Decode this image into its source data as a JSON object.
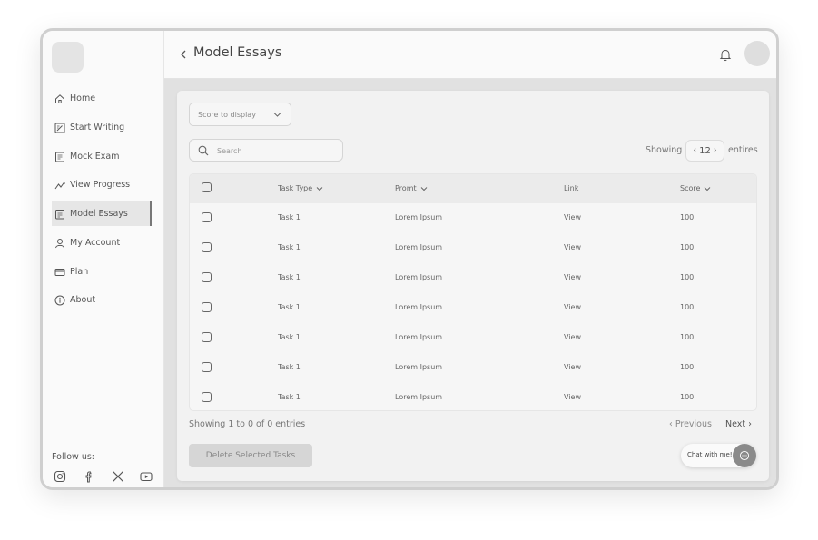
{
  "sidebar": {
    "items": [
      {
        "label": "Home",
        "icon": "home-icon"
      },
      {
        "label": "Start Writing",
        "icon": "edit-icon"
      },
      {
        "label": "Mock Exam",
        "icon": "document-icon"
      },
      {
        "label": "View Progress",
        "icon": "progress-icon"
      },
      {
        "label": "Model Essays",
        "icon": "essay-icon",
        "active": true
      },
      {
        "label": "My Account",
        "icon": "user-icon"
      },
      {
        "label": "Plan",
        "icon": "card-icon"
      },
      {
        "label": "About",
        "icon": "info-icon"
      }
    ],
    "follow_label": "Follow us:",
    "social": [
      "instagram-icon",
      "facebook-icon",
      "x-icon",
      "youtube-icon"
    ]
  },
  "header": {
    "title": "Model Essays"
  },
  "filters": {
    "score_select": "Score to display",
    "search_placeholder": "Search",
    "showing_label": "Showing",
    "entries_count": "12",
    "entries_label": "entires"
  },
  "table": {
    "columns": [
      "Task Type",
      "Promt",
      "Link",
      "Score"
    ],
    "rows": [
      {
        "task": "Task 1",
        "prompt": "Lorem Ipsum",
        "link": "View",
        "score": "100"
      },
      {
        "task": "Task 1",
        "prompt": "Lorem Ipsum",
        "link": "View",
        "score": "100"
      },
      {
        "task": "Task 1",
        "prompt": "Lorem Ipsum",
        "link": "View",
        "score": "100"
      },
      {
        "task": "Task 1",
        "prompt": "Lorem Ipsum",
        "link": "View",
        "score": "100"
      },
      {
        "task": "Task 1",
        "prompt": "Lorem Ipsum",
        "link": "View",
        "score": "100"
      },
      {
        "task": "Task 1",
        "prompt": "Lorem Ipsum",
        "link": "View",
        "score": "100"
      },
      {
        "task": "Task 1",
        "prompt": "Lorem Ipsum",
        "link": "View",
        "score": "100"
      }
    ]
  },
  "footer": {
    "info": "Showing 1 to 0 of 0 entries",
    "prev": "‹ Previous",
    "next": "Next ›",
    "delete_button": "Delete Selected Tasks",
    "chat_label": "Chat with me!"
  }
}
